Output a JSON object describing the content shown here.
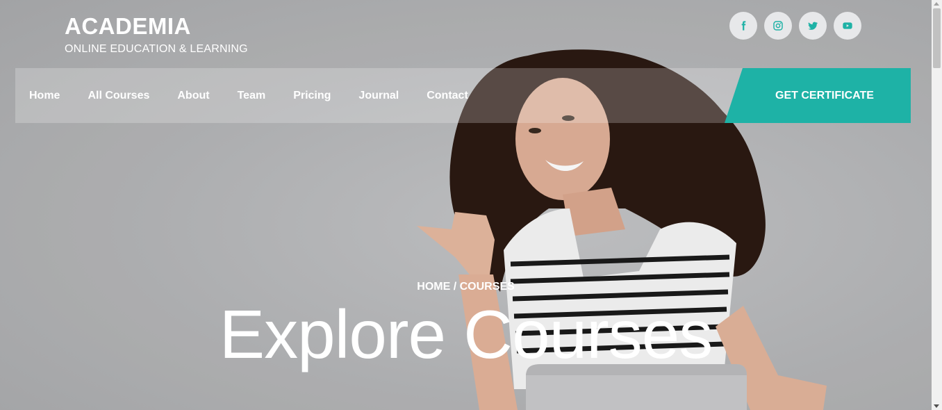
{
  "brand": {
    "title": "ACADEMIA",
    "subtitle": "ONLINE EDUCATION & LEARNING"
  },
  "socials": [
    {
      "icon": "facebook-icon"
    },
    {
      "icon": "instagram-icon"
    },
    {
      "icon": "twitter-icon"
    },
    {
      "icon": "youtube-icon"
    }
  ],
  "nav": {
    "items": [
      {
        "label": "Home"
      },
      {
        "label": "All Courses"
      },
      {
        "label": "About"
      },
      {
        "label": "Team"
      },
      {
        "label": "Pricing"
      },
      {
        "label": "Journal"
      },
      {
        "label": "Contact"
      }
    ],
    "cta_label": "GET CERTIFICATE"
  },
  "hero": {
    "breadcrumb": "HOME / COURSES",
    "headline": "Explore Courses"
  },
  "colors": {
    "accent": "#1eb2a6",
    "social_bg": "#e7e8ea"
  }
}
